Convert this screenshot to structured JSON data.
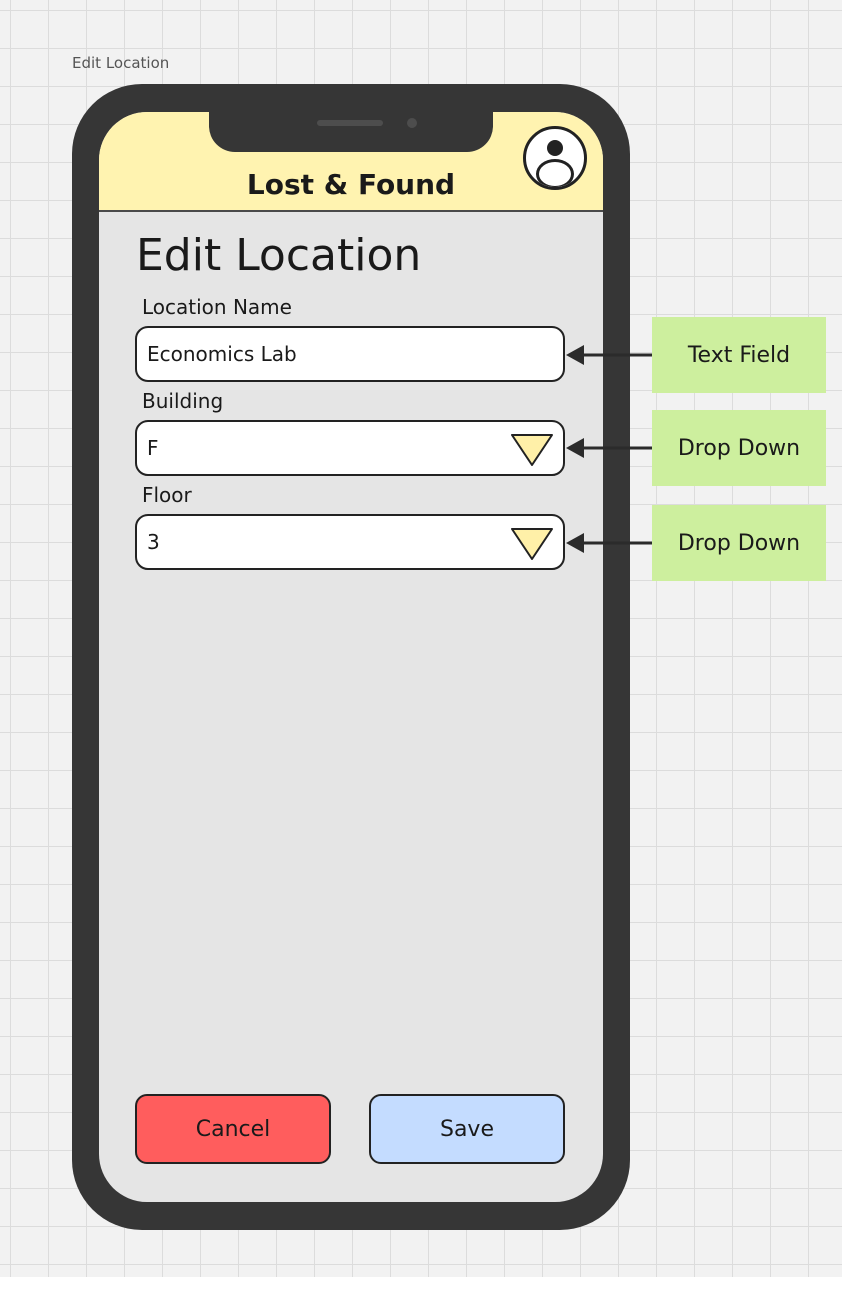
{
  "frame_label": "Edit Location",
  "app": {
    "title": "Lost & Found",
    "profile_icon": "user-profile-icon"
  },
  "page_title": "Edit Location",
  "fields": {
    "location_name": {
      "label": "Location Name",
      "value": "Economics Lab"
    },
    "building": {
      "label": "Building",
      "value": "F",
      "icon": "chevron-down-icon"
    },
    "floor": {
      "label": "Floor",
      "value": "3",
      "icon": "chevron-down-icon"
    }
  },
  "buttons": {
    "cancel": "Cancel",
    "save": "Save"
  },
  "annotations": [
    "Text Field",
    "Drop Down",
    "Drop Down"
  ],
  "colors": {
    "header": "#fff3b0",
    "cancel": "#ff5d5d",
    "save": "#c4dcff",
    "annotation": "#cdef9e",
    "caret": "#fff0a8"
  }
}
